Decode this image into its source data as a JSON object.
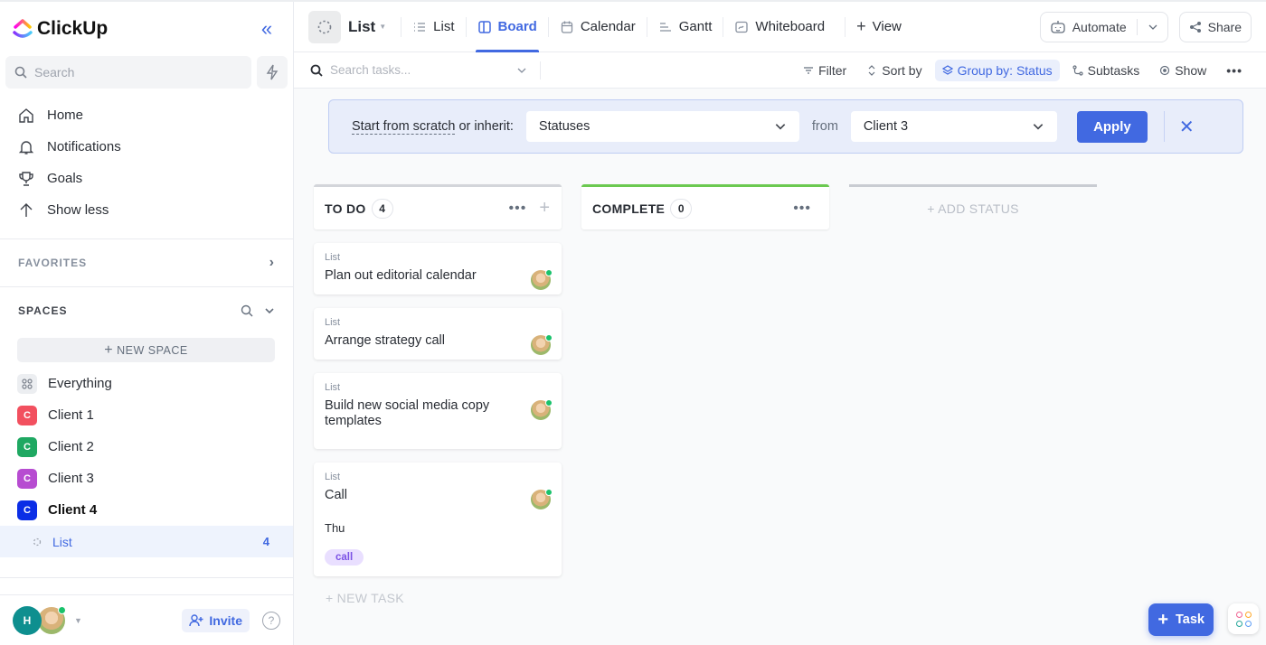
{
  "app": {
    "name": "ClickUp"
  },
  "sidebar": {
    "search_placeholder": "Search",
    "nav": [
      {
        "label": "Home",
        "icon": "home-icon"
      },
      {
        "label": "Notifications",
        "icon": "bell-icon"
      },
      {
        "label": "Goals",
        "icon": "trophy-icon"
      },
      {
        "label": "Show less",
        "icon": "arrow-up-icon"
      }
    ],
    "favorites_label": "FAVORITES",
    "spaces_label": "SPACES",
    "new_space_label": "NEW SPACE",
    "everything_label": "Everything",
    "spaces": [
      {
        "letter": "C",
        "label": "Client 1",
        "color": "#f2505f"
      },
      {
        "letter": "C",
        "label": "Client 2",
        "color": "#1fa862"
      },
      {
        "letter": "C",
        "label": "Client 3",
        "color": "#b74cd1"
      },
      {
        "letter": "C",
        "label": "Client 4",
        "color": "#0b2ee6"
      }
    ],
    "active_list": {
      "label": "List",
      "count": "4"
    },
    "user_initial": "H",
    "invite_label": "Invite",
    "help_glyph": "?"
  },
  "topbar": {
    "list_name": "List",
    "views": [
      {
        "label": "List",
        "icon": "list-icon"
      },
      {
        "label": "Board",
        "icon": "board-icon",
        "active": true
      },
      {
        "label": "Calendar",
        "icon": "calendar-icon"
      },
      {
        "label": "Gantt",
        "icon": "gantt-icon"
      },
      {
        "label": "Whiteboard",
        "icon": "whiteboard-icon"
      }
    ],
    "add_view_label": "View",
    "automate_label": "Automate",
    "share_label": "Share"
  },
  "toolbar": {
    "search_placeholder": "Search tasks...",
    "filter_label": "Filter",
    "sort_label": "Sort by",
    "group_label": "Group by: Status",
    "subtasks_label": "Subtasks",
    "show_label": "Show"
  },
  "banner": {
    "link_text": "Start from scratch",
    "rest_text": " or inherit:",
    "statuses_value": "Statuses",
    "from_label": "from",
    "source_value": "Client 3",
    "apply_label": "Apply"
  },
  "board": {
    "columns": [
      {
        "name": "TO DO",
        "count": "4"
      },
      {
        "name": "COMPLETE",
        "count": "0"
      }
    ],
    "cards": [
      {
        "source": "List",
        "title": "Plan out editorial calendar"
      },
      {
        "source": "List",
        "title": "Arrange strategy call"
      },
      {
        "source": "List",
        "title": "Build new social media copy templates"
      },
      {
        "source": "List",
        "title": "Call",
        "date": "Thu",
        "tag": "call"
      }
    ],
    "new_task_label": "+ NEW TASK",
    "add_status_label": "+ ADD STATUS"
  },
  "fab": {
    "task_label": "Task"
  }
}
